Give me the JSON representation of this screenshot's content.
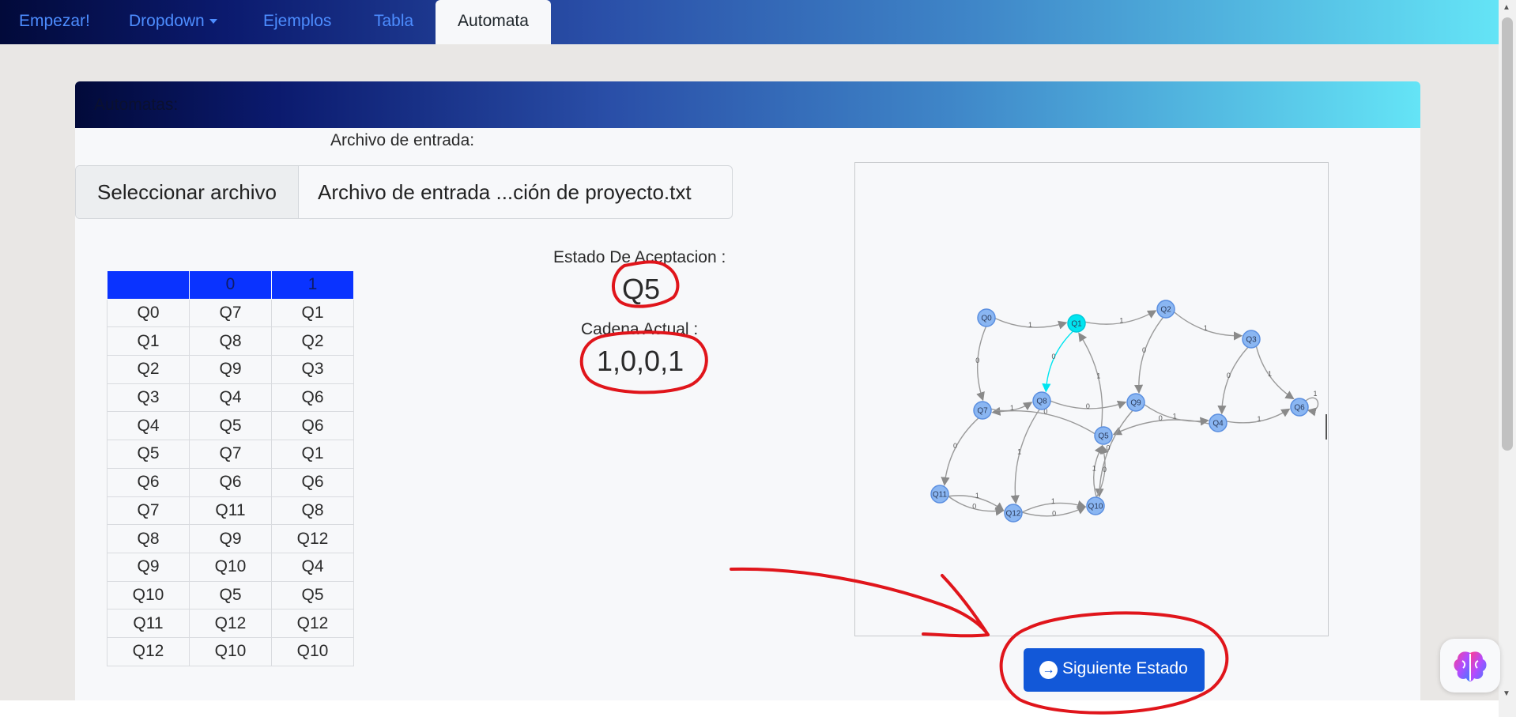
{
  "nav": {
    "items": [
      {
        "label": "Empezar!"
      },
      {
        "label": "Dropdown"
      },
      {
        "label": "Ejemplos"
      },
      {
        "label": "Tabla"
      },
      {
        "label": "Automata"
      }
    ],
    "active": "Automata"
  },
  "card": {
    "header": "Automatas:"
  },
  "file": {
    "label": "Archivo de entrada:",
    "button": "Seleccionar archivo",
    "filename": "Archivo de entrada ...ción de proyecto.txt"
  },
  "table": {
    "headers": [
      "",
      "0",
      "1"
    ],
    "rows": [
      [
        "Q0",
        "Q7",
        "Q1"
      ],
      [
        "Q1",
        "Q8",
        "Q2"
      ],
      [
        "Q2",
        "Q9",
        "Q3"
      ],
      [
        "Q3",
        "Q4",
        "Q6"
      ],
      [
        "Q4",
        "Q5",
        "Q6"
      ],
      [
        "Q5",
        "Q7",
        "Q1"
      ],
      [
        "Q6",
        "Q6",
        "Q6"
      ],
      [
        "Q7",
        "Q11",
        "Q8"
      ],
      [
        "Q8",
        "Q9",
        "Q12"
      ],
      [
        "Q9",
        "Q10",
        "Q4"
      ],
      [
        "Q10",
        "Q5",
        "Q5"
      ],
      [
        "Q11",
        "Q12",
        "Q12"
      ],
      [
        "Q12",
        "Q10",
        "Q10"
      ]
    ]
  },
  "acceptance": {
    "label": "Estado De Aceptacion :",
    "value": "Q5"
  },
  "chain": {
    "label": "Cadena Actual :",
    "value": "1,0,0,1"
  },
  "graph": {
    "highlight_node": "Q1",
    "node_color": "#8ab6f2",
    "highlight_color": "#00e5f0",
    "nodes": [
      "Q0",
      "Q1",
      "Q2",
      "Q3",
      "Q4",
      "Q5",
      "Q6",
      "Q7",
      "Q8",
      "Q9",
      "Q10",
      "Q11",
      "Q12"
    ],
    "edges": [
      {
        "from": "Q0",
        "to": "Q1",
        "label": "1"
      },
      {
        "from": "Q0",
        "to": "Q7",
        "label": "0"
      },
      {
        "from": "Q1",
        "to": "Q2",
        "label": "1"
      },
      {
        "from": "Q1",
        "to": "Q8",
        "label": "0",
        "highlight": true
      },
      {
        "from": "Q2",
        "to": "Q3",
        "label": "1"
      },
      {
        "from": "Q2",
        "to": "Q9",
        "label": "0"
      },
      {
        "from": "Q3",
        "to": "Q6",
        "label": "1"
      },
      {
        "from": "Q3",
        "to": "Q4",
        "label": "0"
      },
      {
        "from": "Q4",
        "to": "Q6",
        "label": "1"
      },
      {
        "from": "Q4",
        "to": "Q5",
        "label": "0"
      },
      {
        "from": "Q5",
        "to": "Q1",
        "label": "1"
      },
      {
        "from": "Q5",
        "to": "Q7",
        "label": "0"
      },
      {
        "from": "Q6",
        "to": "Q6",
        "label": "1"
      },
      {
        "from": "Q7",
        "to": "Q8",
        "label": "1"
      },
      {
        "from": "Q7",
        "to": "Q11",
        "label": "0"
      },
      {
        "from": "Q8",
        "to": "Q9",
        "label": "0"
      },
      {
        "from": "Q8",
        "to": "Q12",
        "label": "1"
      },
      {
        "from": "Q9",
        "to": "Q4",
        "label": "1"
      },
      {
        "from": "Q9",
        "to": "Q10",
        "label": "0"
      },
      {
        "from": "Q10",
        "to": "Q5",
        "label": "0"
      },
      {
        "from": "Q10",
        "to": "Q5",
        "label": "1"
      },
      {
        "from": "Q11",
        "to": "Q12",
        "label": "0"
      },
      {
        "from": "Q11",
        "to": "Q12",
        "label": "1"
      },
      {
        "from": "Q12",
        "to": "Q10",
        "label": "0"
      },
      {
        "from": "Q12",
        "to": "Q10",
        "label": "1"
      }
    ]
  },
  "next_button": {
    "label": "Siguiente Estado",
    "icon": "arrow-right-circle-icon"
  },
  "annotations": {
    "color": "#e0151b"
  },
  "widget": {
    "icon": "brain-icon"
  }
}
